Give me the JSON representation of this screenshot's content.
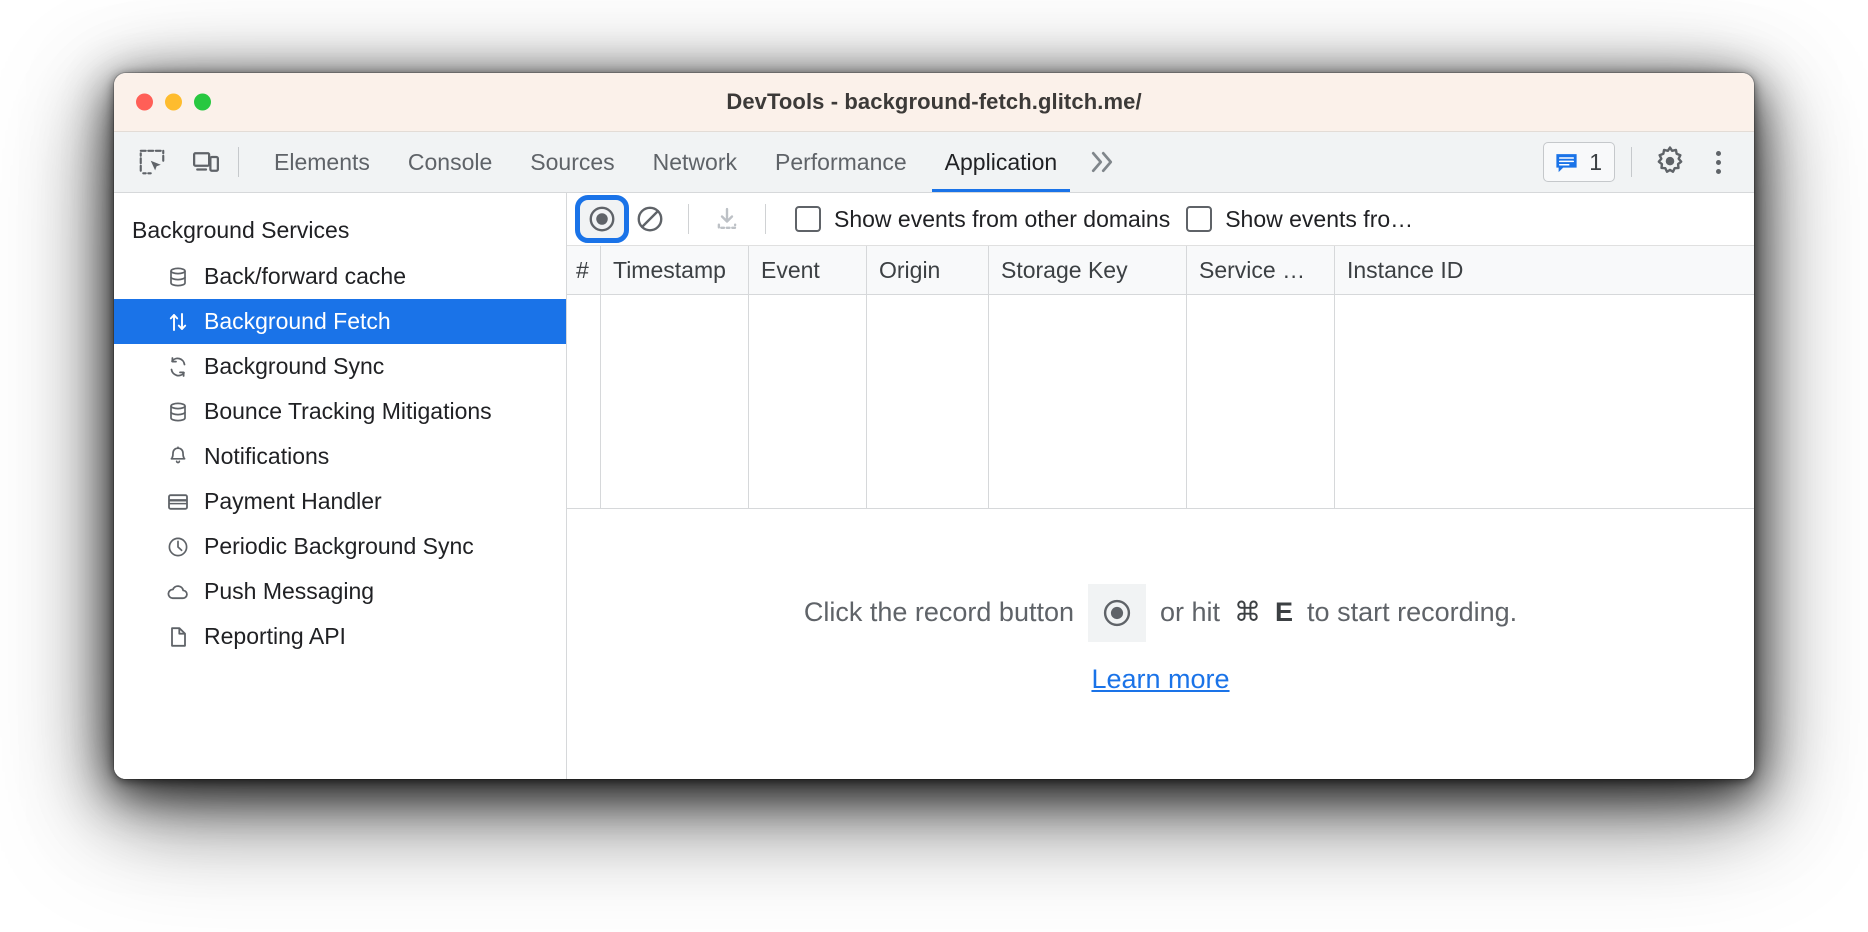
{
  "window": {
    "title": "DevTools - background-fetch.glitch.me/",
    "traffic_lights": [
      "close-red",
      "minimize-yellow",
      "zoom-green"
    ]
  },
  "devtools_toolbar": {
    "inspect_icon": "inspect-element-icon",
    "device_icon": "device-toolbar-icon",
    "tabs": [
      {
        "label": "Elements",
        "selected": false
      },
      {
        "label": "Console",
        "selected": false
      },
      {
        "label": "Sources",
        "selected": false
      },
      {
        "label": "Network",
        "selected": false
      },
      {
        "label": "Performance",
        "selected": false
      },
      {
        "label": "Application",
        "selected": true
      }
    ],
    "more_tabs_label": "»",
    "message_count": "1",
    "message_icon": "console-message-icon",
    "settings_icon": "gear-icon",
    "menu_icon": "three-dot-vertical-icon"
  },
  "sidebar": {
    "section_title": "Background Services",
    "items": [
      {
        "label": "Back/forward cache",
        "icon": "database-icon",
        "selected": false
      },
      {
        "label": "Background Fetch",
        "icon": "arrows-up-down-icon",
        "selected": true
      },
      {
        "label": "Background Sync",
        "icon": "sync-refresh-icon",
        "selected": false
      },
      {
        "label": "Bounce Tracking Mitigations",
        "icon": "database-icon",
        "selected": false
      },
      {
        "label": "Notifications",
        "icon": "bell-icon",
        "selected": false
      },
      {
        "label": "Payment Handler",
        "icon": "credit-card-icon",
        "selected": false
      },
      {
        "label": "Periodic Background Sync",
        "icon": "clock-icon",
        "selected": false
      },
      {
        "label": "Push Messaging",
        "icon": "cloud-icon",
        "selected": false
      },
      {
        "label": "Reporting API",
        "icon": "document-icon",
        "selected": false
      }
    ],
    "selection_color": "#1a73e8"
  },
  "panel_toolbar": {
    "record_button": {
      "icon": "record-circle-icon",
      "focused": true,
      "tooltip_name": "record"
    },
    "clear_button": {
      "icon": "clear-ban-icon"
    },
    "download_button": {
      "icon": "download-icon",
      "disabled": true
    },
    "checkboxes": [
      {
        "label": "Show events from other domains",
        "checked": false
      },
      {
        "label": "Show events fro…",
        "checked": false
      }
    ]
  },
  "table": {
    "columns": [
      "#",
      "Timestamp",
      "Event",
      "Origin",
      "Storage Key",
      "Service …",
      "Instance ID"
    ],
    "rows": []
  },
  "empty_state": {
    "text_before": "Click the record button",
    "record_icon": "record-circle-icon",
    "text_middle": "or hit",
    "kbd_modifier": "⌘",
    "kbd_key": "E",
    "text_after": "to start recording.",
    "link_label": "Learn more",
    "link_color": "#1a73e8"
  }
}
